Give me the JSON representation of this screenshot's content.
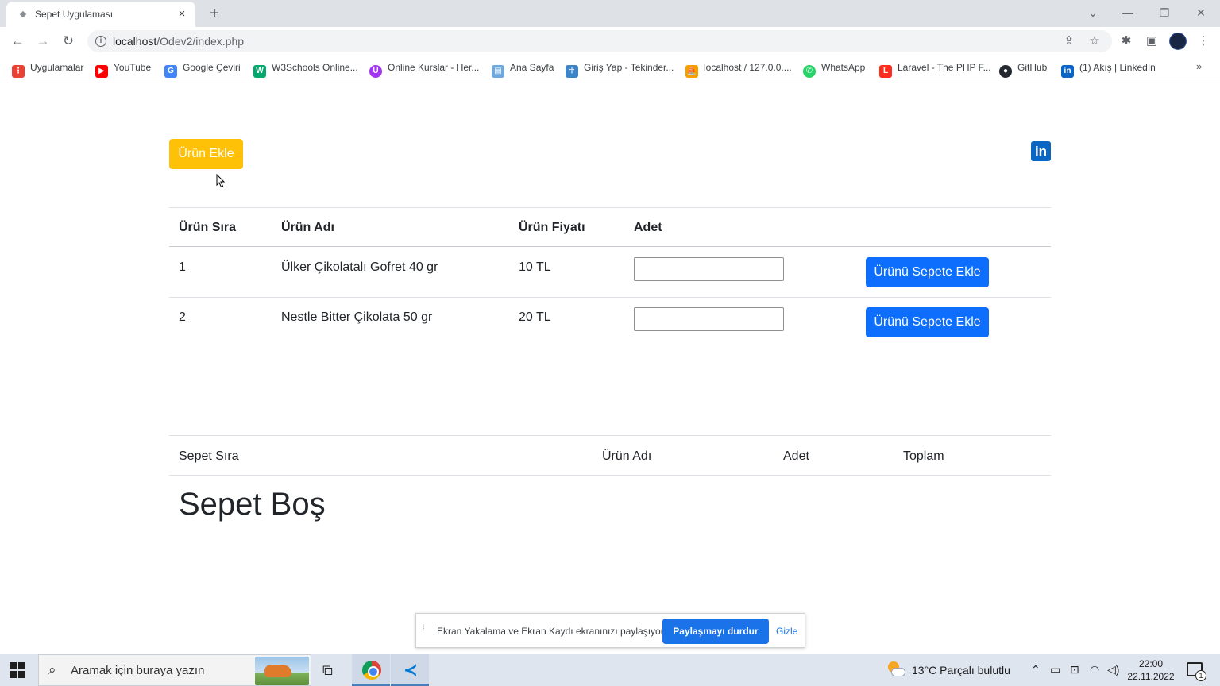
{
  "browser": {
    "tab_title": "Sepet Uygulaması",
    "url_host": "localhost",
    "url_path": "/Odev2/index.php",
    "bookmarks": [
      {
        "label": "Uygulamalar",
        "icon": "apps-grid-icon",
        "color": "#e94235"
      },
      {
        "label": "YouTube",
        "icon": "youtube-icon",
        "color": "#ff0000"
      },
      {
        "label": "Google Çeviri",
        "icon": "google-translate-icon",
        "color": "#4285f4"
      },
      {
        "label": "W3Schools Online...",
        "icon": "w3schools-icon",
        "color": "#04aa6d"
      },
      {
        "label": "Online Kurslar - Her...",
        "icon": "udemy-icon",
        "color": "#a435f0"
      },
      {
        "label": "Ana Sayfa",
        "icon": "chart-icon",
        "color": "#6fa8dc"
      },
      {
        "label": "Giriş Yap - Tekinder...",
        "icon": "figure-icon",
        "color": "#3d85c6"
      },
      {
        "label": "localhost / 127.0.0....",
        "icon": "phpmyadmin-icon",
        "color": "#f6a000"
      },
      {
        "label": "WhatsApp",
        "icon": "whatsapp-icon",
        "color": "#25d366"
      },
      {
        "label": "Laravel - The PHP F...",
        "icon": "laravel-icon",
        "color": "#ff2d20"
      },
      {
        "label": "GitHub",
        "icon": "github-icon",
        "color": "#24292f"
      },
      {
        "label": "(1) Akış | LinkedIn",
        "icon": "linkedin-icon",
        "color": "#0a66c2"
      }
    ]
  },
  "page": {
    "add_product_button": "Ürün Ekle",
    "linkedin_logo": "in",
    "products_table": {
      "headers": [
        "Ürün Sıra",
        "Ürün Adı",
        "Ürün Fiyatı",
        "Adet"
      ],
      "rows": [
        {
          "index": "1",
          "name": "Ülker Çikolatalı Gofret 40 gr",
          "price": "10 TL",
          "qty": "",
          "button": "Ürünü Sepete Ekle"
        },
        {
          "index": "2",
          "name": "Nestle Bitter Çikolata 50 gr",
          "price": "20 TL",
          "qty": "",
          "button": "Ürünü Sepete Ekle"
        }
      ]
    },
    "cart_table": {
      "headers": [
        "Sepet Sıra",
        "Ürün Adı",
        "Adet",
        "Toplam"
      ]
    },
    "empty_cart_message": "Sepet Boş"
  },
  "share_bar": {
    "message": "Ekran Yakalama ve Ekran Kaydı ekranınızı paylaşıyor.",
    "stop_button": "Paylaşmayı durdur",
    "hide_link": "Gizle"
  },
  "taskbar": {
    "search_placeholder": "Aramak için buraya yazın",
    "weather": "13°C  Parçalı bulutlu",
    "time": "22:00",
    "date": "22.11.2022",
    "notification_count": "1"
  }
}
